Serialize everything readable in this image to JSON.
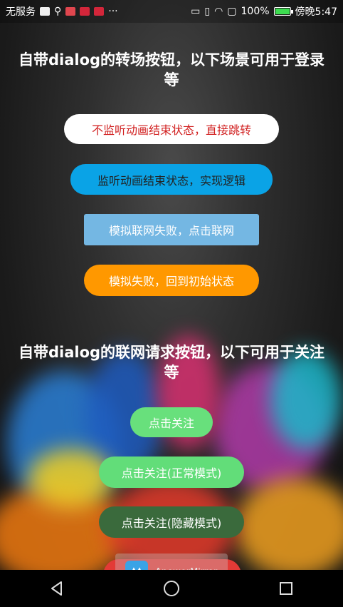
{
  "status_bar": {
    "carrier": "无服务",
    "dots": "···",
    "battery": "100%",
    "time": "傍晚5:47"
  },
  "section1": {
    "title": "自带dialog的转场按钮，以下场景可用于登录等",
    "buttons": [
      {
        "label": "不监听动画结束状态，直接跳转"
      },
      {
        "label": "监听动画结束状态，实现逻辑"
      },
      {
        "label": "模拟联网失败，点击联网"
      },
      {
        "label": "模拟失败，回到初始状态"
      }
    ]
  },
  "section2": {
    "title": "自带dialog的联网请求按钮，以下可用于关注等",
    "buttons": [
      {
        "label": "点击关注"
      },
      {
        "label": "点击关注(正常模式)"
      },
      {
        "label": "点击关注(隐藏模式)"
      }
    ]
  },
  "watermark": {
    "label": "ApowerMirror"
  },
  "colors": {
    "red_text": "#d11f1f",
    "blue": "#0aa3e6",
    "light_blue": "#74b7e3",
    "orange": "#ff9800",
    "green_light": "#68e07c",
    "green_mid": "#62dd79",
    "green_dark": "#3a6a3c"
  }
}
